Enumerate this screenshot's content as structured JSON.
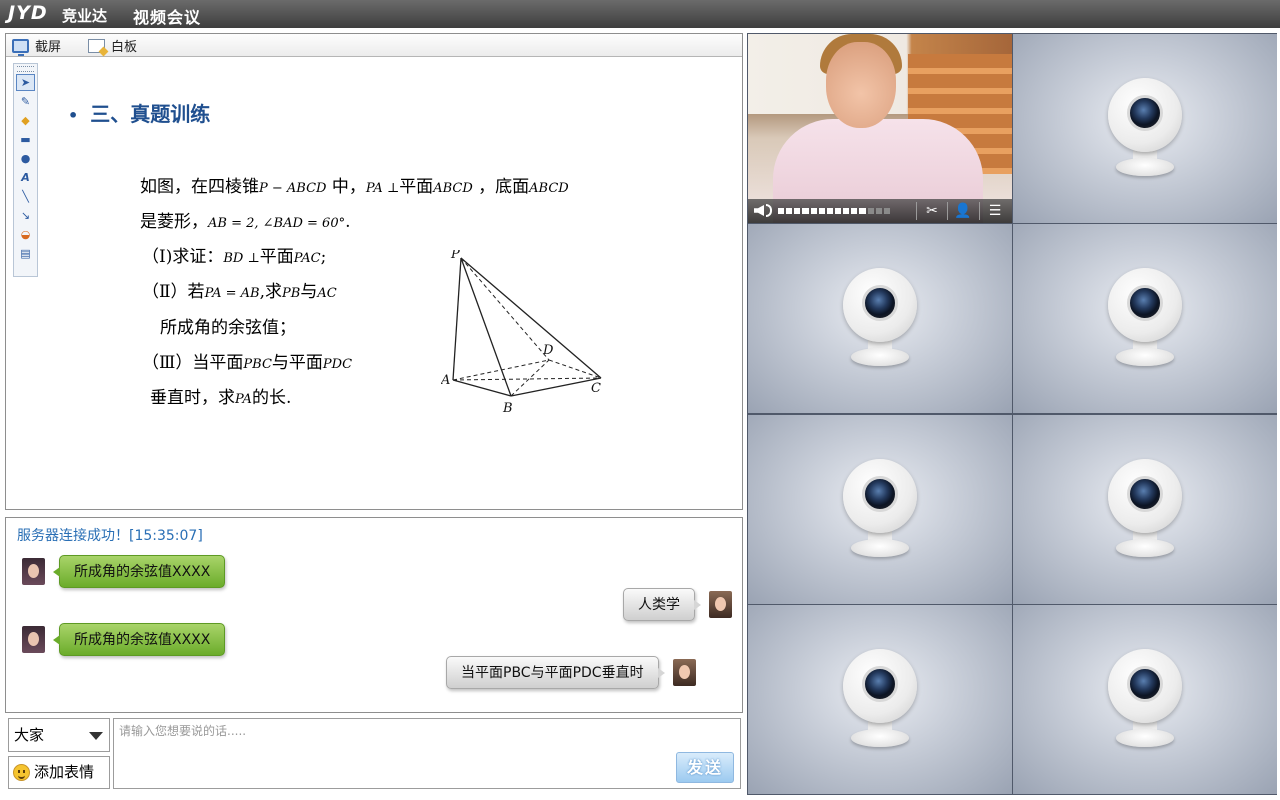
{
  "header": {
    "logo": "JYD",
    "logo_sub": "竞业达",
    "title": "视频会议"
  },
  "presentation": {
    "toolbar": {
      "capture_label": "截屏",
      "whiteboard_label": "白板"
    },
    "tools": [
      "select-icon",
      "pen-icon",
      "highlighter-icon",
      "rectangle-icon",
      "ellipse-icon",
      "text-icon",
      "line-icon",
      "arrow-icon",
      "color-icon",
      "layer-icon"
    ],
    "slide": {
      "heading": "三、真题训练",
      "lines": [
        {
          "pre": "如图，在四棱锥",
          "math1": "P − ABCD",
          "mid": " 中，",
          "math2": "PA ⊥",
          "mid2": "平面",
          "math3": "ABCD",
          "post": " ，底面",
          "math4": "ABCD"
        },
        {
          "pre": "是菱形，",
          "math1": "AB = 2, ∠BAD = 60°",
          "post": "."
        },
        {
          "pre": "（Ⅰ)求证：",
          "math1": "BD ⊥",
          "mid": "平面",
          "math2": "PAC",
          "post": ";"
        },
        {
          "pre": "（Ⅱ）若",
          "math1": "PA = AB",
          "mid": ",求",
          "math2": "PB",
          "mid2": "与",
          "math3": "AC"
        },
        {
          "pre": "所成角的余弦值；"
        },
        {
          "pre": "（Ⅲ）当平面",
          "math1": "PBC",
          "mid": "与平面",
          "math2": "PDC"
        },
        {
          "pre": "垂直时，求",
          "math1": "PA",
          "post": "的长."
        }
      ],
      "figure_labels": {
        "p": "P",
        "a": "A",
        "b": "B",
        "c": "C",
        "d": "D"
      }
    }
  },
  "chat": {
    "status": "服务器连接成功！[15:35:07]",
    "messages": [
      {
        "side": "left",
        "avatar": "girl-avatar",
        "text": "所成角的余弦值XXXX"
      },
      {
        "side": "right",
        "avatar": "woman-avatar",
        "text": "人类学"
      },
      {
        "side": "left",
        "avatar": "girl-avatar",
        "text": "所成角的余弦值XXXX"
      },
      {
        "side": "right",
        "avatar": "woman-avatar",
        "text": "当平面PBC与平面PDC垂直时"
      }
    ],
    "recipient": "大家",
    "emoji_label": "添加表情",
    "input_placeholder": "请输入您想要说的话.....",
    "send_label": "发送"
  },
  "video": {
    "volume_level": 0.8,
    "controls": [
      "scissors-icon",
      "add-user-icon",
      "list-icon"
    ],
    "empty_slots": 7
  }
}
